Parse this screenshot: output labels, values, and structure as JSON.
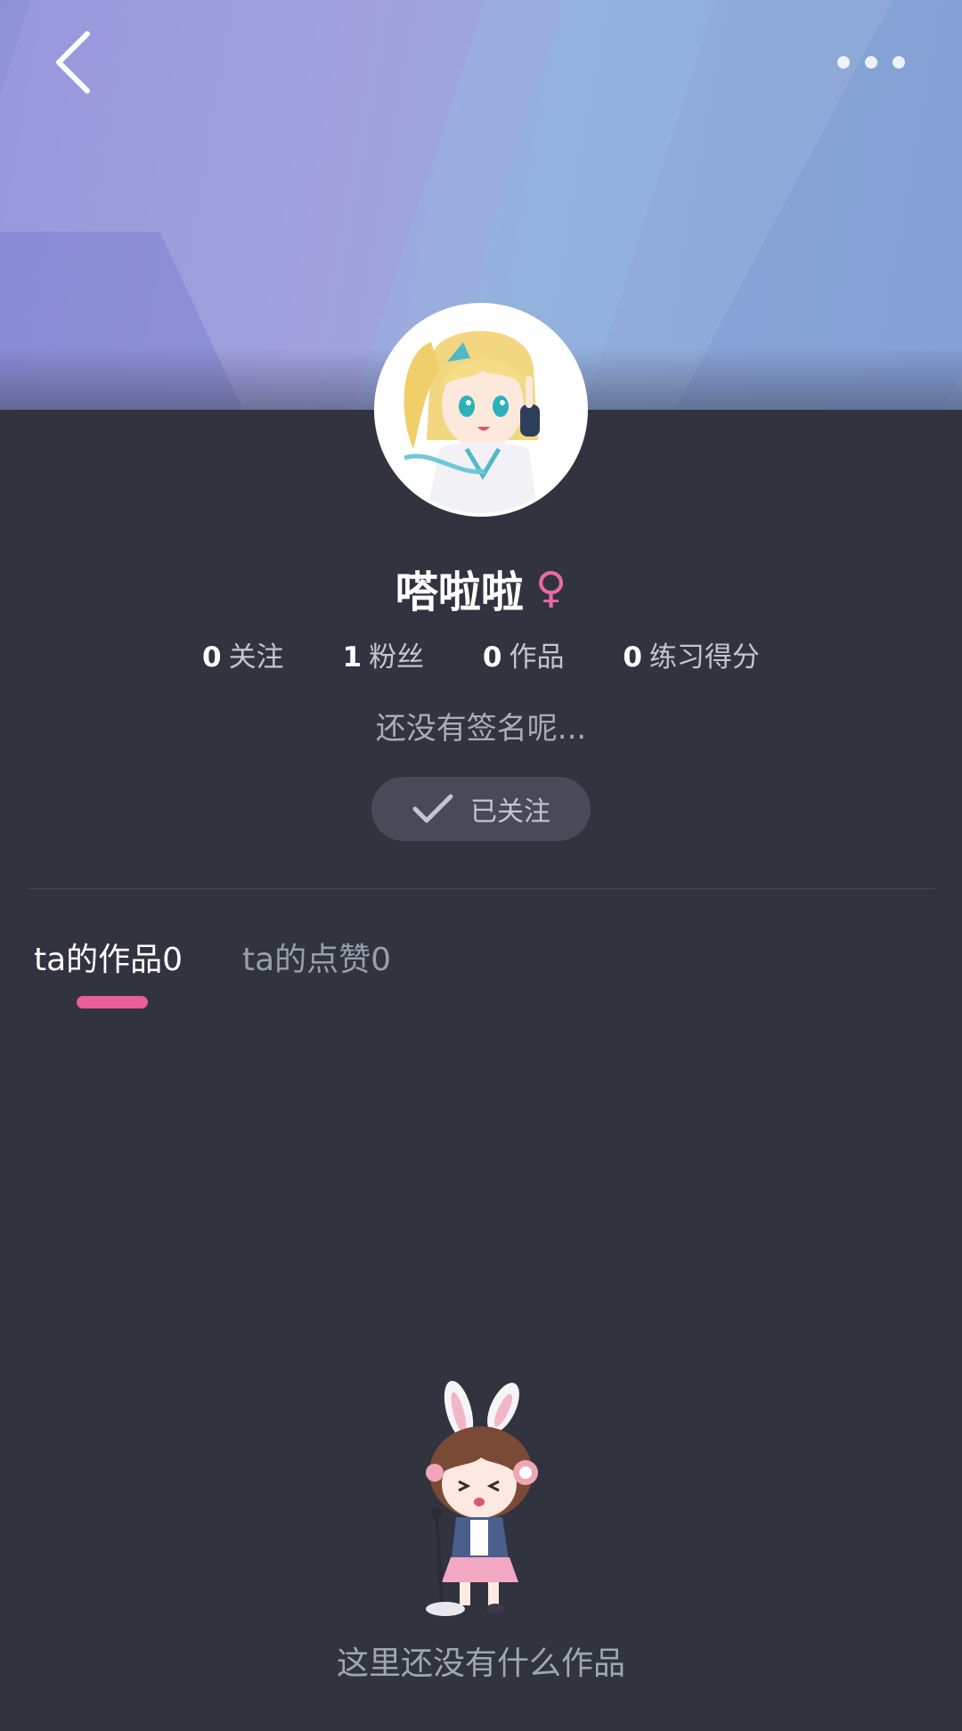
{
  "header": {
    "back_icon": "chevron-left-icon",
    "more_icon": "more-horizontal-icon"
  },
  "profile": {
    "name": "嗒啦啦",
    "gender_symbol": "♀",
    "gender_color": "#e86aa4",
    "avatar": "anime-girl-avatar",
    "signature": "还没有签名呢..."
  },
  "stats": [
    {
      "value": "0",
      "label": "关注"
    },
    {
      "value": "1",
      "label": "粉丝"
    },
    {
      "value": "0",
      "label": "作品"
    },
    {
      "value": "0",
      "label": "练习得分"
    }
  ],
  "follow_button": {
    "label": "已关注",
    "icon": "check-icon"
  },
  "tabs": [
    {
      "label": "ta的作品0",
      "active": true
    },
    {
      "label": "ta的点赞0",
      "active": false
    }
  ],
  "accent_color": "#ea5f98",
  "empty_state": {
    "illustration": "bunny-girl-mascot",
    "text": "这里还没有什么作品"
  }
}
